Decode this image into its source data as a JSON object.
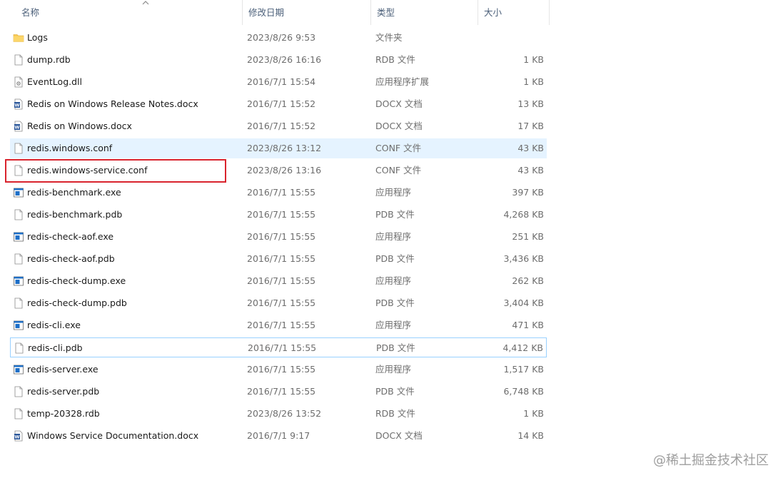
{
  "columns": {
    "name": "名称",
    "date": "修改日期",
    "type": "类型",
    "size": "大小"
  },
  "files": [
    {
      "name": "Logs",
      "date": "2023/8/26 9:53",
      "type": "文件夹",
      "size": "",
      "icon": "folder-icon"
    },
    {
      "name": "dump.rdb",
      "date": "2023/8/26 16:16",
      "type": "RDB 文件",
      "size": "1 KB",
      "icon": "file-icon"
    },
    {
      "name": "EventLog.dll",
      "date": "2016/7/1 15:54",
      "type": "应用程序扩展",
      "size": "1 KB",
      "icon": "dll-icon"
    },
    {
      "name": "Redis on Windows Release Notes.docx",
      "date": "2016/7/1 15:52",
      "type": "DOCX 文档",
      "size": "13 KB",
      "icon": "word-doc-icon"
    },
    {
      "name": "Redis on Windows.docx",
      "date": "2016/7/1 15:52",
      "type": "DOCX 文档",
      "size": "17 KB",
      "icon": "word-doc-icon"
    },
    {
      "name": "redis.windows.conf",
      "date": "2023/8/26 13:12",
      "type": "CONF 文件",
      "size": "43 KB",
      "icon": "file-icon"
    },
    {
      "name": "redis.windows-service.conf",
      "date": "2023/8/26 13:16",
      "type": "CONF 文件",
      "size": "43 KB",
      "icon": "file-icon"
    },
    {
      "name": "redis-benchmark.exe",
      "date": "2016/7/1 15:55",
      "type": "应用程序",
      "size": "397 KB",
      "icon": "exe-icon"
    },
    {
      "name": "redis-benchmark.pdb",
      "date": "2016/7/1 15:55",
      "type": "PDB 文件",
      "size": "4,268 KB",
      "icon": "file-icon"
    },
    {
      "name": "redis-check-aof.exe",
      "date": "2016/7/1 15:55",
      "type": "应用程序",
      "size": "251 KB",
      "icon": "exe-icon"
    },
    {
      "name": "redis-check-aof.pdb",
      "date": "2016/7/1 15:55",
      "type": "PDB 文件",
      "size": "3,436 KB",
      "icon": "file-icon"
    },
    {
      "name": "redis-check-dump.exe",
      "date": "2016/7/1 15:55",
      "type": "应用程序",
      "size": "262 KB",
      "icon": "exe-icon"
    },
    {
      "name": "redis-check-dump.pdb",
      "date": "2016/7/1 15:55",
      "type": "PDB 文件",
      "size": "3,404 KB",
      "icon": "file-icon"
    },
    {
      "name": "redis-cli.exe",
      "date": "2016/7/1 15:55",
      "type": "应用程序",
      "size": "471 KB",
      "icon": "exe-icon"
    },
    {
      "name": "redis-cli.pdb",
      "date": "2016/7/1 15:55",
      "type": "PDB 文件",
      "size": "4,412 KB",
      "icon": "file-icon"
    },
    {
      "name": "redis-server.exe",
      "date": "2016/7/1 15:55",
      "type": "应用程序",
      "size": "1,517 KB",
      "icon": "exe-icon"
    },
    {
      "name": "redis-server.pdb",
      "date": "2016/7/1 15:55",
      "type": "PDB 文件",
      "size": "6,748 KB",
      "icon": "file-icon"
    },
    {
      "name": "temp-20328.rdb",
      "date": "2023/8/26 13:52",
      "type": "RDB 文件",
      "size": "1 KB",
      "icon": "file-icon"
    },
    {
      "name": "Windows Service Documentation.docx",
      "date": "2016/7/1 9:17",
      "type": "DOCX 文档",
      "size": "14 KB",
      "icon": "word-doc-icon"
    }
  ],
  "hovered_file": "redis.windows.conf",
  "focused_file": "redis-cli.pdb",
  "annotated_file": "redis.windows-service.conf",
  "colors": {
    "hover": "#e5f3ff",
    "focus_border": "#99d1ff",
    "annotation_box": "#d9232d",
    "folder": "#f8c74e",
    "word": "#2b579a",
    "exe": "#1e6fc7"
  },
  "watermark": "@稀土掘金技术社区"
}
